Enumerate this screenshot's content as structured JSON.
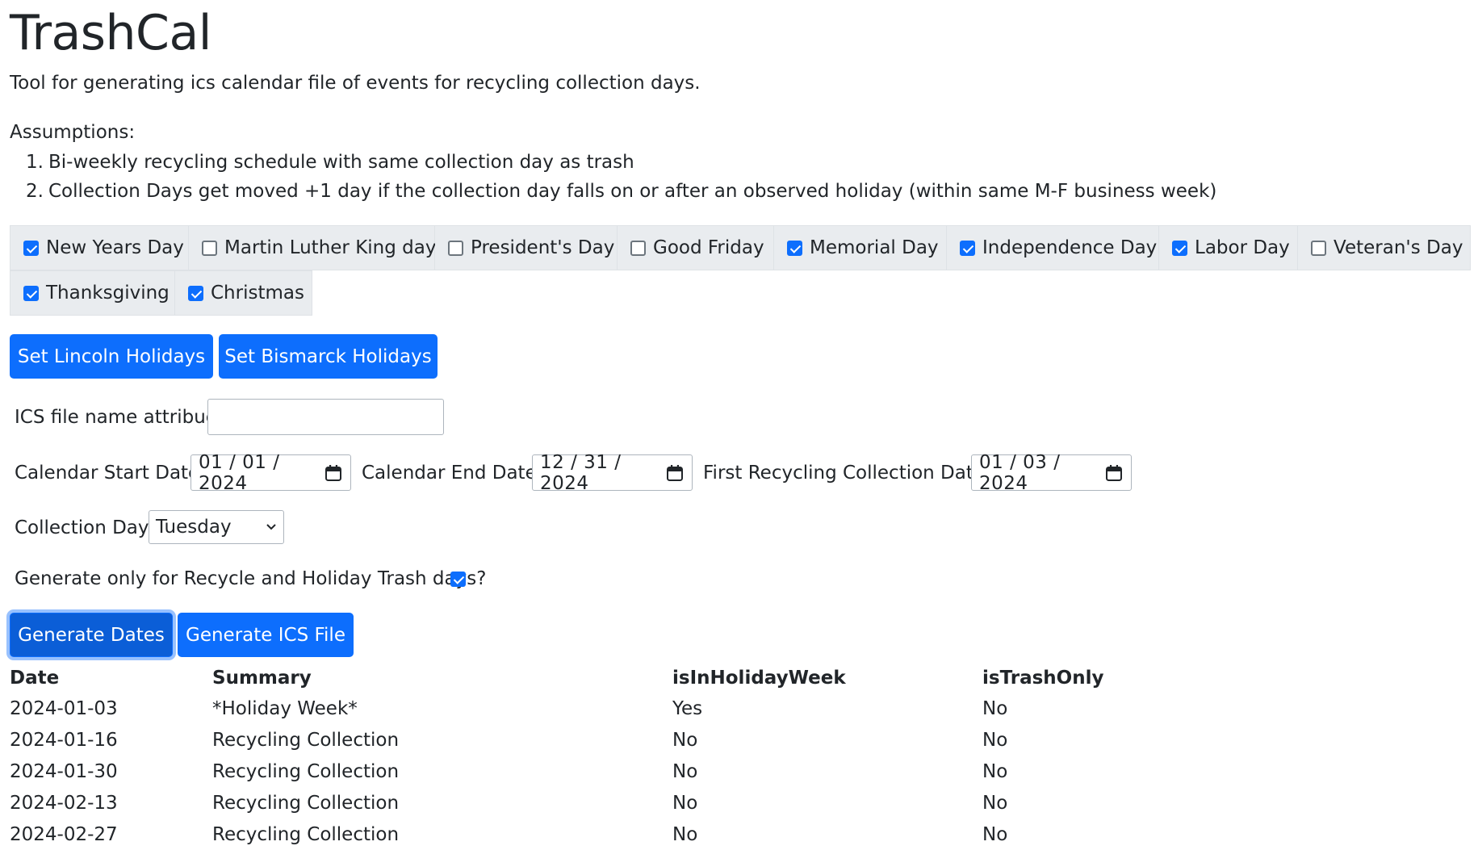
{
  "app": {
    "title": "TrashCal",
    "description": "Tool for generating ics calendar file of events for recycling collection days.",
    "assumptions_title": "Assumptions:",
    "assumptions": [
      {
        "num": "1.",
        "text": "Bi-weekly recycling schedule with same collection day as trash"
      },
      {
        "num": "2.",
        "text": "Collection Days get moved +1 day if the collection day falls on or after an observed holiday (within same M-F business week)"
      }
    ]
  },
  "holidays": {
    "row1": [
      {
        "label": "New Years Day",
        "checked": true
      },
      {
        "label": "Martin Luther King day",
        "checked": false
      },
      {
        "label": "President's Day",
        "checked": false
      },
      {
        "label": "Good Friday",
        "checked": false
      },
      {
        "label": "Memorial Day",
        "checked": true
      },
      {
        "label": "Independence Day",
        "checked": true
      },
      {
        "label": "Labor Day",
        "checked": true
      },
      {
        "label": "Veteran's Day",
        "checked": false
      }
    ],
    "row2": [
      {
        "label": "Thanksgiving",
        "checked": true
      },
      {
        "label": "Christmas",
        "checked": true
      }
    ]
  },
  "presets": {
    "lincoln_label": "Set Lincoln Holidays",
    "bismarck_label": "Set Bismarck Holidays"
  },
  "form": {
    "filename_label": "ICS file name attribue:",
    "filename_value": "",
    "start_label": "Calendar Start Date:",
    "start_value": "01 / 01 / 2024",
    "end_label": "Calendar End Date:",
    "end_value": "12 / 31 / 2024",
    "first_label": "First Recycling Collection Date:",
    "first_value": "01 / 03 / 2024",
    "day_label": "Collection Day:",
    "day_value": "Tuesday",
    "only_label": "Generate only for Recycle and Holiday Trash days?",
    "only_checked": true
  },
  "actions": {
    "generate_dates": "Generate Dates",
    "generate_ics": "Generate ICS File"
  },
  "table": {
    "headers": [
      "Date",
      "Summary",
      "isInHolidayWeek",
      "isTrashOnly"
    ],
    "rows": [
      [
        "2024-01-03",
        "*Holiday Week*",
        "Yes",
        "No"
      ],
      [
        "2024-01-16",
        "Recycling Collection",
        "No",
        "No"
      ],
      [
        "2024-01-30",
        "Recycling Collection",
        "No",
        "No"
      ],
      [
        "2024-02-13",
        "Recycling Collection",
        "No",
        "No"
      ],
      [
        "2024-02-27",
        "Recycling Collection",
        "No",
        "No"
      ]
    ]
  },
  "colors": {
    "primary": "#0d6efd",
    "cell_bg": "#e9ecef"
  }
}
